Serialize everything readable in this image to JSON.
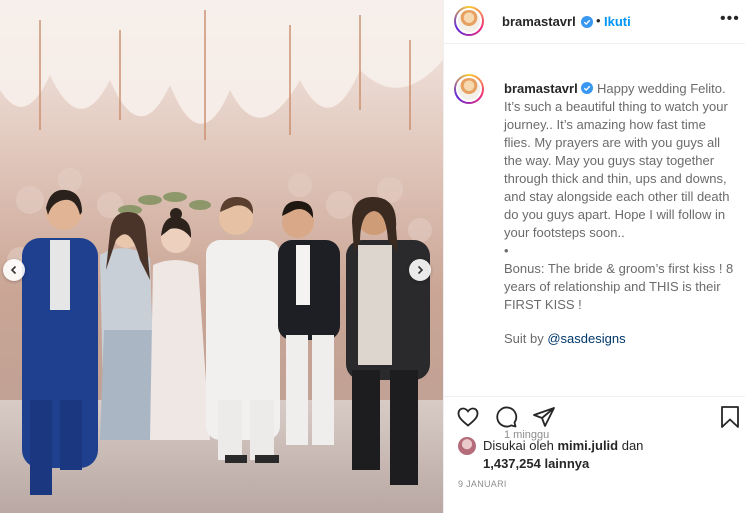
{
  "post": {
    "username": "bramastavrl",
    "follow_label": "Ikuti",
    "separator": "•",
    "more_label": "•••"
  },
  "caption": {
    "username": "bramastavrl",
    "text": "Happy wedding Felito. It’s such a beautiful thing to watch your journey.. It’s amazing how fast time flies. My prayers are with you guys all the way. May you guys stay together through thick and thin, ups and downs, and stay alongside each other till death do you guys apart. Hope I will follow in your footsteps soon..",
    "bullet": "•",
    "bonus": "Bonus: The bride & groom’s first kiss ! 8 years of relationship and THIS is their FIRST KISS !",
    "suit_prefix": "Suit by ",
    "suit_mention": "@sasdesigns",
    "time_ago": "1 minggu"
  },
  "likes": {
    "prefix": "Disukai oleh ",
    "liked_by": "mimi.julid",
    "and": " dan",
    "count": "1,437,254",
    "others": " lainnya"
  },
  "date": "9 JANUARI",
  "icons": {
    "like": "heart-icon",
    "comment": "comment-icon",
    "share": "share-icon",
    "save": "bookmark-icon",
    "verified": "verified-badge-icon",
    "prev": "chevron-left-icon",
    "next": "chevron-right-icon"
  },
  "colors": {
    "link": "#0095f6",
    "verified": "#3897f0",
    "text": "#262626",
    "muted": "#8e8e8e"
  }
}
